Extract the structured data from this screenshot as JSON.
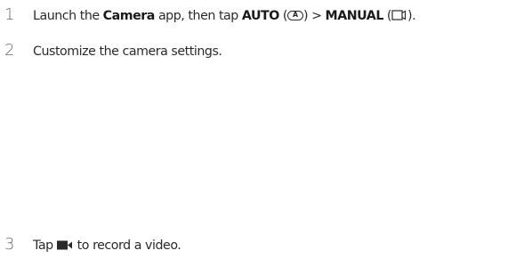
{
  "steps": [
    {
      "number": "1",
      "parts": {
        "t1": "Launch the",
        "camera": "Camera",
        "t2": "app, then tap",
        "auto": "AUTO",
        "auto_open": "(",
        "auto_icon_letter": "A",
        "auto_close": ")",
        "sep": ">",
        "manual": "MANUAL",
        "manual_open": "(",
        "manual_close": ")."
      },
      "icons": [
        "auto-mode-icon",
        "manual-mode-icon"
      ]
    },
    {
      "number": "2",
      "text": "Customize the camera settings."
    },
    {
      "number": "3",
      "parts": {
        "t1": "Tap",
        "t2": "to record a video."
      },
      "icons": [
        "video-record-icon"
      ]
    }
  ]
}
